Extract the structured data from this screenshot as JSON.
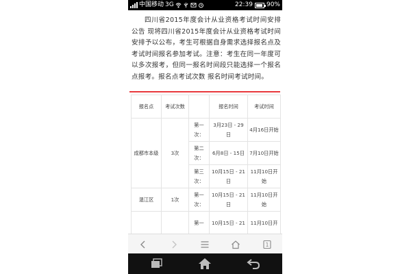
{
  "status_bar": {
    "carrier": "中国移动",
    "network": "3G",
    "time": "22:39",
    "battery": "90%",
    "battery_level": 0.9
  },
  "article": {
    "text": "四川省2015年度会计从业资格考试时间安排公告 现将四川省2015年度会计从业资格考试时间安排予以公布，考生可根据自身需求选择报名点及考试时间报名参加考试。注意：考生在同一年度可以多次报考，但同一报名时间段只能选择一个报名点报考。报名点考试次数 报名时间考试时间。"
  },
  "table": {
    "headers": [
      "报名点",
      "考试次数",
      "",
      "报名时间",
      "考试时间"
    ],
    "groups": [
      {
        "site": "成都市本级",
        "count": "3次",
        "rows": [
          {
            "round": "第一次：",
            "reg": "3月23日 - 29日",
            "exam": "4月16日开始"
          },
          {
            "round": "第二次：",
            "reg": "6月8日 - 15日",
            "exam": "7月10日开始"
          },
          {
            "round": "第三次：",
            "reg": "10月15日 - 21日",
            "exam": "11月10日开始"
          }
        ]
      },
      {
        "site": "温江区",
        "count": "1次",
        "rows": [
          {
            "round": "第一次：",
            "reg": "10月15日 - 21日",
            "exam": "11月10日开始"
          }
        ]
      },
      {
        "site": "",
        "count": "",
        "rows": [
          {
            "round": "第一",
            "reg": "10月15日 - 21",
            "exam": "11月10日开"
          }
        ]
      }
    ]
  },
  "browser_toolbar": {
    "tab_count": "1"
  },
  "icons": {
    "back": "chevron-left-icon",
    "forward": "chevron-right-icon",
    "menu": "menu-icon",
    "home": "home-icon",
    "tabs": "tabs-icon",
    "recent_apps": "recent-apps-icon",
    "system_home": "system-home-icon",
    "system_back": "system-back-icon"
  },
  "colors": {
    "status_bar": "#000000",
    "accent_rule": "#e8373b",
    "nav_bar": "#111111",
    "toolbar": "#f5f5f5"
  }
}
